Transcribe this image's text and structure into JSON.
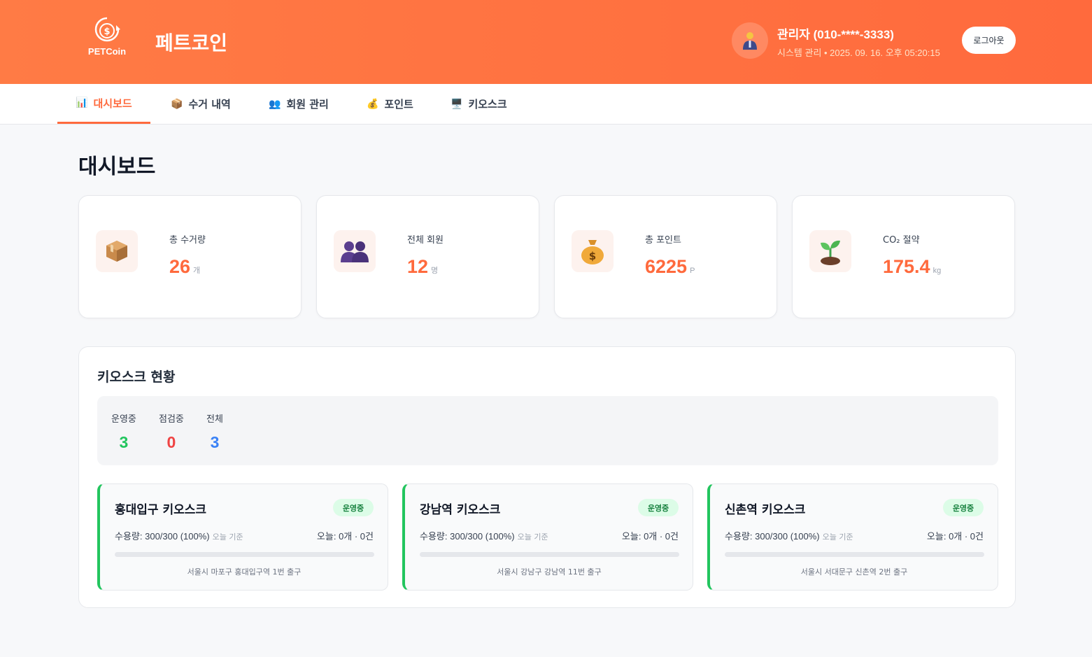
{
  "header": {
    "logo_text": "PETCoin",
    "app_title": "페트코인",
    "user_name": "관리자 (010-****-3333)",
    "user_sub": "시스템 관리 • 2025. 09. 16. 오후 05:20:15",
    "logout_label": "로그아웃",
    "colors": {
      "primary": "#ff6a3d"
    }
  },
  "nav": {
    "items": [
      {
        "icon": "bar-chart-icon",
        "glyph": "📊",
        "label": "대시보드",
        "active": true
      },
      {
        "icon": "package-icon",
        "glyph": "📦",
        "label": "수거 내역",
        "active": false
      },
      {
        "icon": "users-icon",
        "glyph": "👥",
        "label": "회원 관리",
        "active": false
      },
      {
        "icon": "money-bag-icon",
        "glyph": "💰",
        "label": "포인트",
        "active": false
      },
      {
        "icon": "monitor-icon",
        "glyph": "🖥️",
        "label": "키오스크",
        "active": false
      }
    ]
  },
  "page_title": "대시보드",
  "stats": [
    {
      "icon": "package-icon",
      "glyph": "📦",
      "label": "총 수거량",
      "value": "26",
      "unit": "개"
    },
    {
      "icon": "users-icon",
      "glyph": "👥",
      "label": "전체 회원",
      "value": "12",
      "unit": "명"
    },
    {
      "icon": "money-bag-icon",
      "glyph": "💰",
      "label": "총 포인트",
      "value": "6225",
      "unit": "P"
    },
    {
      "icon": "seedling-icon",
      "glyph": "🌱",
      "label": "CO₂ 절약",
      "value": "175.4",
      "unit": "kg"
    }
  ],
  "kiosk_panel": {
    "title": "키오스크 현황",
    "summary": [
      {
        "label": "운영중",
        "value": "3",
        "color": "#22c55e"
      },
      {
        "label": "점검중",
        "value": "0",
        "color": "#ef4444"
      },
      {
        "label": "전체",
        "value": "3",
        "color": "#3b82f6"
      }
    ],
    "kiosks": [
      {
        "name": "홍대입구 키오스크",
        "status": "운영중",
        "capacity": "수용량: 300/300 (100%)",
        "capacity_note": "오늘 기준",
        "today": "오늘: 0개 · 0건",
        "fill_pct": 0,
        "address": "서울시 마포구 홍대입구역 1번 출구"
      },
      {
        "name": "강남역 키오스크",
        "status": "운영중",
        "capacity": "수용량: 300/300 (100%)",
        "capacity_note": "오늘 기준",
        "today": "오늘: 0개 · 0건",
        "fill_pct": 0,
        "address": "서울시 강남구 강남역 11번 출구"
      },
      {
        "name": "신촌역 키오스크",
        "status": "운영중",
        "capacity": "수용량: 300/300 (100%)",
        "capacity_note": "오늘 기준",
        "today": "오늘: 0개 · 0건",
        "fill_pct": 0,
        "address": "서울시 서대문구 신촌역 2번 출구"
      }
    ]
  }
}
